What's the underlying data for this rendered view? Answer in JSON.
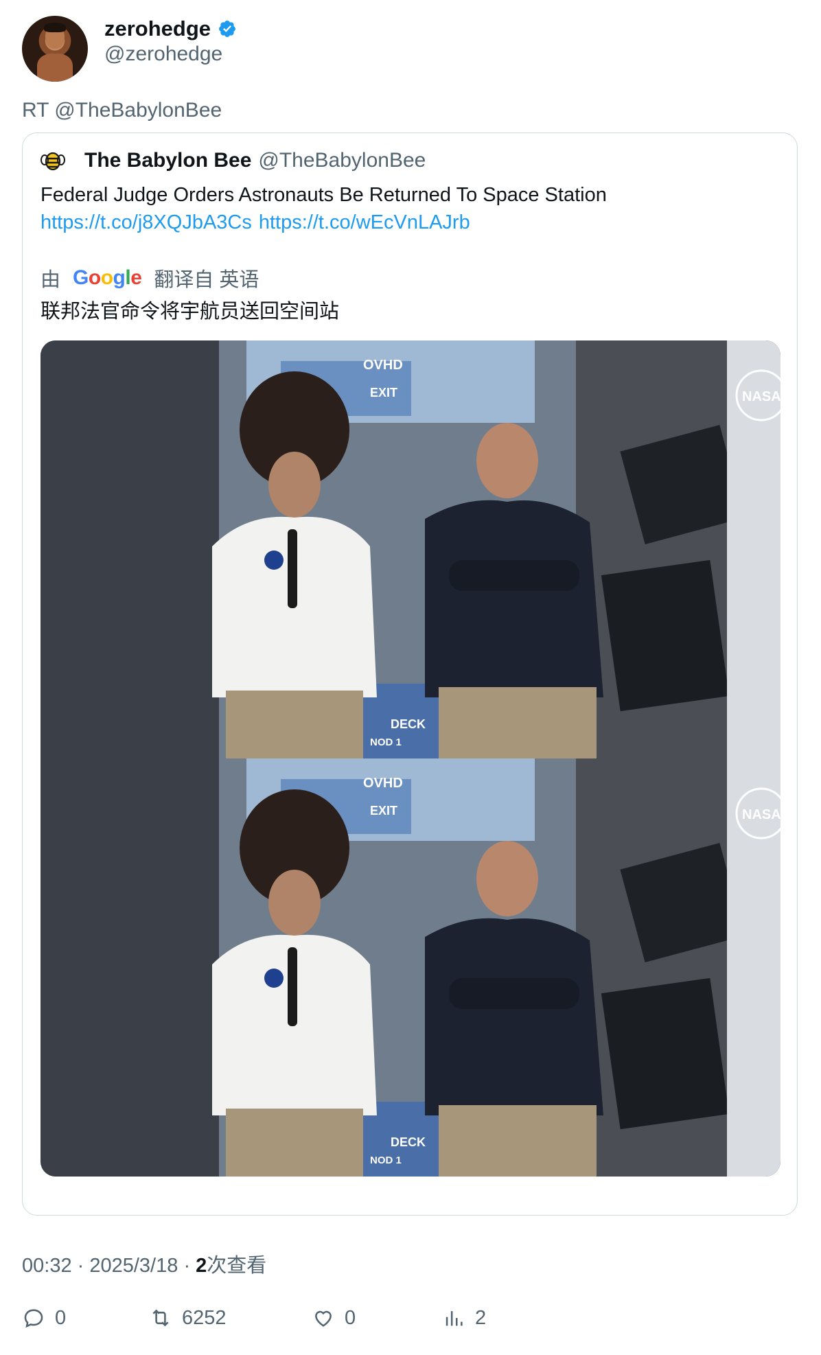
{
  "author": {
    "display_name": "zerohedge",
    "handle": "@zerohedge",
    "verified": true,
    "verified_color": "#1d9bf0"
  },
  "retweet_line": "RT @TheBabylonBee",
  "quote": {
    "display_name": "The Babylon Bee",
    "handle": "@TheBabylonBee",
    "text": "Federal Judge Orders Astronauts Be Returned To Space Station",
    "links": [
      "https://t.co/j8XQJbA3Cs",
      "https://t.co/wEcVnLAJrb"
    ],
    "translate_prefix": "由",
    "translate_provider": "Google",
    "translate_suffix": "翻译自 英语",
    "translated_text": "联邦法官命令将宇航员送回空间站",
    "media_labels": {
      "ovhd": "OVHD",
      "exit": "EXIT",
      "deck": "DECK",
      "nod": "NOD 1",
      "nasa": "NASA"
    }
  },
  "meta": {
    "time": "00:32",
    "date": "2025/3/18",
    "views_count": "2",
    "views_label": "次查看"
  },
  "actions": {
    "reply_count": "0",
    "retweet_count": "6252",
    "like_count": "0",
    "views_count": "2"
  },
  "colors": {
    "link": "#1d9bf0",
    "secondary_text": "#536471",
    "border": "#cfd9de"
  }
}
